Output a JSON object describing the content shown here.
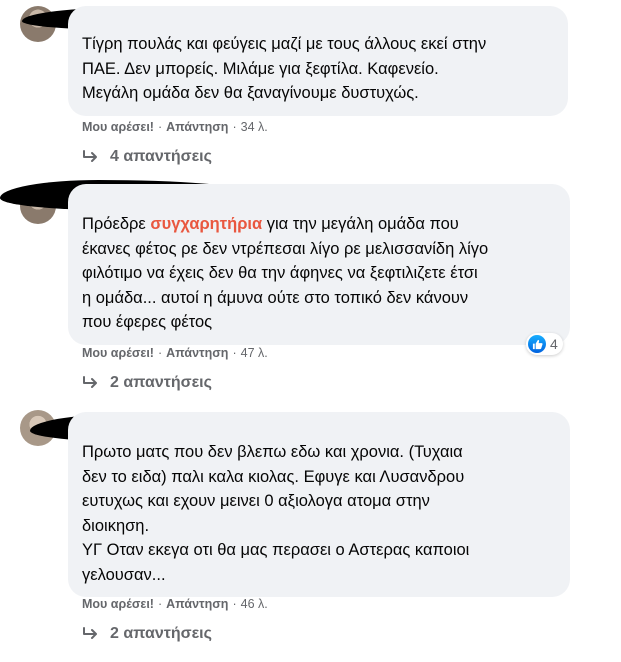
{
  "comments": [
    {
      "text_lines": [
        "Τίγρη πουλάς και φεύγεις μαζί με τους άλλους εκεί στην",
        "ΠΑΕ. Δεν μπορείς. Μιλάμε για ξεφτίλα. Καφενείο.",
        "Μεγάλη ομάδα δεν θα ξαναγίνουμε δυστυχώς."
      ],
      "like_label": "Μου αρέσει!",
      "reply_label": "Απάντηση",
      "time": "34 λ.",
      "replies_label": "4 απαντήσεις"
    },
    {
      "text_before": "Πρόεδρε ",
      "text_highlight": "συγχαρητήρια",
      "text_after_first": " για την μεγάλη ομάδα που",
      "text_lines_rest": [
        "έκανες φέτος ρε δεν ντρέπεσαι λίγο ρε μελισσανίδη λίγο",
        "φιλότιμο να έχεις δεν θα την άφηνες να ξεφτιλιζετε έτσι",
        "η ομάδα... αυτοί η άμυνα ούτε στο τοπικό δεν κάνουν",
        "που έφερες φέτος"
      ],
      "like_label": "Μου αρέσει!",
      "reply_label": "Απάντηση",
      "time": "47 λ.",
      "reaction_count": "4",
      "replies_label": "2 απαντήσεις"
    },
    {
      "text_lines": [
        "Πρωτο ματς που δεν βλεπω εδω και χρονια. (Τυχαια",
        "δεν το ειδα) παλι καλα κιολας. Εφυγε και Λυσανδρου",
        "ευτυχως και εχουν μεινει 0 αξιολογα ατομα στην",
        "διοικηση.",
        "ΥΓ Οταν εκεγα οτι θα μας περασει ο Αστερας καποιοι",
        "γελουσαν..."
      ],
      "like_label": "Μου αρέσει!",
      "reply_label": "Απάντηση",
      "time": "46 λ.",
      "replies_label": "2 απαντήσεις"
    }
  ],
  "colors": {
    "bubble_bg": "#f0f2f5",
    "highlight": "#e9573f",
    "meta_text": "#65676b",
    "like_blue": "#1877f2"
  },
  "icons": {
    "reply_arrow": "reply-arrow-icon",
    "like": "like-thumb-icon"
  }
}
